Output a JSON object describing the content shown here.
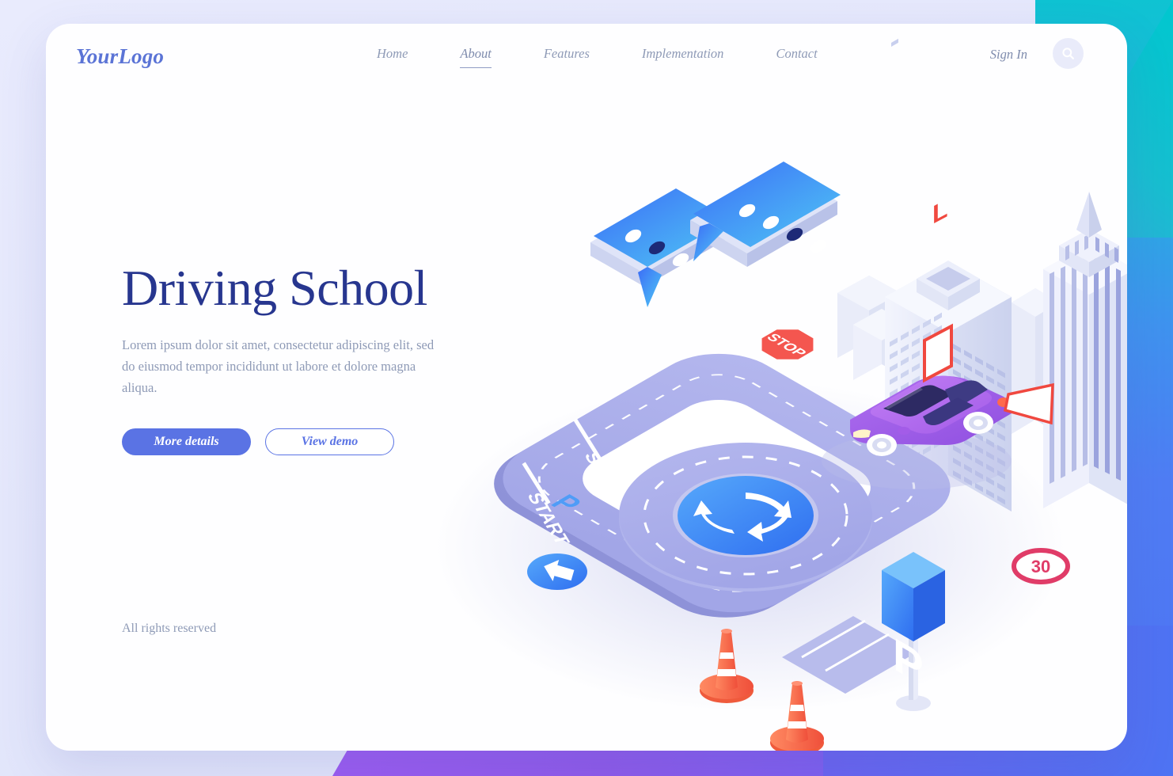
{
  "page": {
    "background_colors": {
      "base": "#e6e8fb",
      "teal_accent": "#00c7cf",
      "blue_accent": "#4e73f3",
      "purple_accent": "#9b5cf0"
    },
    "card_background": "#fefeff"
  },
  "header": {
    "logo": "YourLogo",
    "logo_color": "#5b74d6",
    "nav": [
      {
        "label": "Home",
        "active": false
      },
      {
        "label": "About",
        "active": true
      },
      {
        "label": "Features",
        "active": false
      },
      {
        "label": "Implementation",
        "active": false
      },
      {
        "label": "Contact",
        "active": false
      }
    ],
    "sign_in": "Sign In",
    "search_icon": "search-icon"
  },
  "hero": {
    "title": "Driving School",
    "title_color": "#27368f",
    "subtitle": "Lorem ipsum dolor sit amet, consectetur adipiscing elit, sed do eiusmod tempor incididunt ut labore et dolore magna aliqua.",
    "primary_button": "More details",
    "secondary_button": "View demo",
    "primary_button_color": "#5a73e4"
  },
  "footer": {
    "rights": "All rights reserved"
  },
  "illustration": {
    "name": "isometric-driving-school-scene",
    "road_color": "#a9acea",
    "road_markings_color": "#ffffff",
    "labels": {
      "road_stop_marking": "STOP",
      "road_start_marking": "START",
      "stop_sign": "STOP",
      "speed_limit_sign": "30",
      "parking_sign": "P",
      "parking_space_marking": "P",
      "learner_plate": "L"
    },
    "elements": [
      {
        "name": "chat-bubble-left",
        "type": "speech-bubble",
        "color": "#3b6ef5"
      },
      {
        "name": "chat-bubble-right",
        "type": "speech-bubble",
        "color": "#3b6ef5"
      },
      {
        "name": "office-building",
        "type": "building",
        "color": "#e6e9f8"
      },
      {
        "name": "tower-building",
        "type": "building",
        "color": "#eceffb"
      },
      {
        "name": "learner-car",
        "type": "vehicle",
        "color": "#a35ce8"
      },
      {
        "name": "roundabout-sign",
        "type": "road-sign",
        "color": "#3f8ef7"
      },
      {
        "name": "direction-arrow-sign",
        "type": "road-sign",
        "color": "#3f8ef7"
      },
      {
        "name": "stop-sign",
        "type": "road-sign",
        "color": "#f4564f"
      },
      {
        "name": "speed-limit-sign",
        "type": "road-sign",
        "color": "#e03c68"
      },
      {
        "name": "parking-sign",
        "type": "road-sign",
        "color": "#3f8ef7"
      },
      {
        "name": "traffic-cone-1",
        "type": "traffic-cone",
        "color": "#f4603f"
      },
      {
        "name": "traffic-cone-2",
        "type": "traffic-cone",
        "color": "#f4603f"
      }
    ]
  }
}
